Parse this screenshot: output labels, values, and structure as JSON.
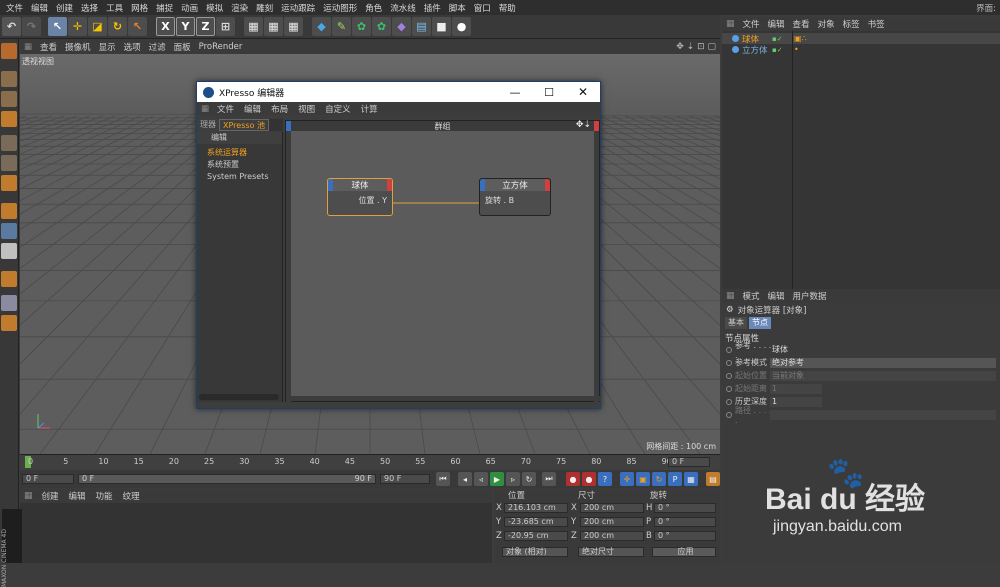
{
  "menubar": {
    "items": [
      "文件",
      "编辑",
      "创建",
      "选择",
      "工具",
      "网格",
      "捕捉",
      "动画",
      "模拟",
      "渲染",
      "雕刻",
      "运动跟踪",
      "运动图形",
      "角色",
      "流水线",
      "插件",
      "脚本",
      "窗口",
      "帮助"
    ],
    "layout_label": "界面:"
  },
  "viewport": {
    "menu": [
      "查看",
      "摄像机",
      "显示",
      "选项",
      "过滤",
      "面板",
      "ProRender"
    ],
    "label": "透视视图",
    "grid_distance": "网格间距 : 100 cm"
  },
  "timeline": {
    "ticks": [
      "0",
      "5",
      "10",
      "15",
      "20",
      "25",
      "30",
      "35",
      "40",
      "45",
      "50",
      "55",
      "60",
      "65",
      "70",
      "75",
      "80",
      "85",
      "90"
    ],
    "current_frame": "0 F"
  },
  "playbar": {
    "start": "0 F",
    "current": "0 F",
    "end_field": "90 F",
    "end": "90 F"
  },
  "material_panel": {
    "menu": [
      "创建",
      "编辑",
      "功能",
      "纹理"
    ],
    "logo": "MAXON CINEMA 4D"
  },
  "coord_panel": {
    "headers": [
      "位置",
      "尺寸",
      "旋转"
    ],
    "rows": [
      {
        "axis": "X",
        "pos": "216.103 cm",
        "size_axis": "X",
        "size": "200 cm",
        "rot_axis": "H",
        "rot": "0 °"
      },
      {
        "axis": "Y",
        "pos": "-23.685 cm",
        "size_axis": "Y",
        "size": "200 cm",
        "rot_axis": "P",
        "rot": "0 °"
      },
      {
        "axis": "Z",
        "pos": "-20.95 cm",
        "size_axis": "Z",
        "size": "200 cm",
        "rot_axis": "B",
        "rot": "0 °"
      }
    ],
    "mode": "对象 (相对)",
    "size_mode": "绝对尺寸",
    "apply": "应用"
  },
  "object_manager": {
    "menu": [
      "文件",
      "编辑",
      "查看",
      "对象",
      "标签",
      "书签"
    ],
    "objects": [
      "球体",
      "立方体"
    ]
  },
  "attr_panel": {
    "menu": [
      "模式",
      "编辑",
      "用户数据"
    ],
    "title": "对象运算器 [对象]",
    "tabs": [
      "基本",
      "节点"
    ],
    "section": "节点属性",
    "rows": [
      {
        "label": "参考 . . . . .",
        "value": "球体"
      },
      {
        "label": "参考模式",
        "value": "绝对参考"
      },
      {
        "label": "起始位置",
        "value": "当前对象"
      },
      {
        "label": "起始距离",
        "value": "1"
      },
      {
        "label": "历史深度",
        "value": "1"
      },
      {
        "label": "路径 . . . . .",
        "value": ""
      }
    ]
  },
  "xpresso": {
    "title": "XPresso 编辑器",
    "menu": [
      "文件",
      "编辑",
      "布局",
      "视图",
      "自定义",
      "计算"
    ],
    "tabs": [
      "理器",
      "XPresso 池"
    ],
    "pool_header": "编辑",
    "tree": [
      "系统运算器",
      "系统预置",
      "System Presets"
    ],
    "group_title": "群组",
    "node_sphere": {
      "title": "球体",
      "port": "位置 . Y"
    },
    "node_cube": {
      "title": "立方体",
      "port": "旋转 . B"
    }
  },
  "watermark": {
    "brand": "Bai du 经验",
    "url": "jingyan.baidu.com"
  }
}
